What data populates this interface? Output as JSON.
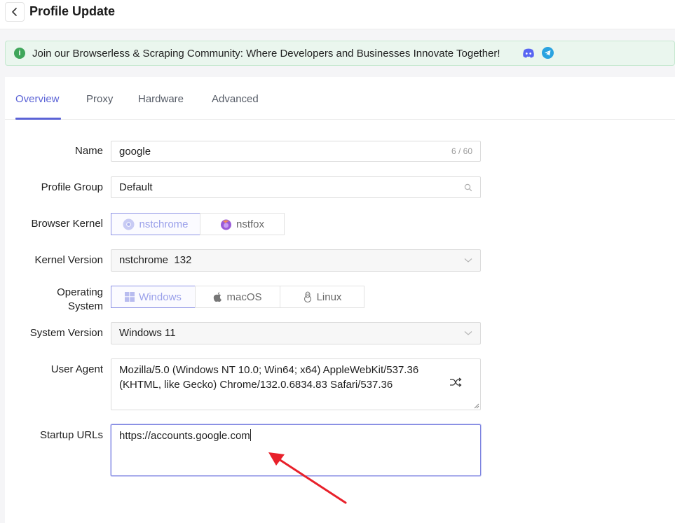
{
  "header": {
    "title": "Profile Update",
    "back_icon": "chevron-left-icon"
  },
  "banner": {
    "text": "Join our Browserless & Scraping Community: Where Developers and Businesses Innovate Together!",
    "info_icon": "info-icon",
    "links": [
      "discord-icon",
      "telegram-icon"
    ],
    "color": "#eaf6ee"
  },
  "tabs": [
    {
      "label": "Overview",
      "active": true
    },
    {
      "label": "Proxy",
      "active": false
    },
    {
      "label": "Hardware",
      "active": false
    },
    {
      "label": "Advanced",
      "active": false
    }
  ],
  "form": {
    "name": {
      "label": "Name",
      "value": "google",
      "counter": "6 / 60"
    },
    "profile_group": {
      "label": "Profile Group",
      "value": "Default"
    },
    "browser_kernel": {
      "label": "Browser Kernel",
      "options": [
        "nstchrome",
        "nstfox"
      ],
      "selected": "nstchrome"
    },
    "kernel_version": {
      "label": "Kernel Version",
      "value": "nstchrome  132"
    },
    "operating_system": {
      "label_line1": "Operating",
      "label_line2": "System",
      "options": [
        "Windows",
        "macOS",
        "Linux"
      ],
      "selected": "Windows"
    },
    "system_version": {
      "label": "System Version",
      "value": "Windows 11"
    },
    "user_agent": {
      "label": "User Agent",
      "value": "Mozilla/5.0 (Windows NT 10.0; Win64; x64) AppleWebKit/537.36 (KHTML, like Gecko) Chrome/132.0.6834.83 Safari/537.36"
    },
    "startup_urls": {
      "label": "Startup URLs",
      "value": "https://accounts.google.com"
    }
  },
  "colors": {
    "accent": "#5b63d6",
    "annotation_arrow": "#e8202a"
  }
}
